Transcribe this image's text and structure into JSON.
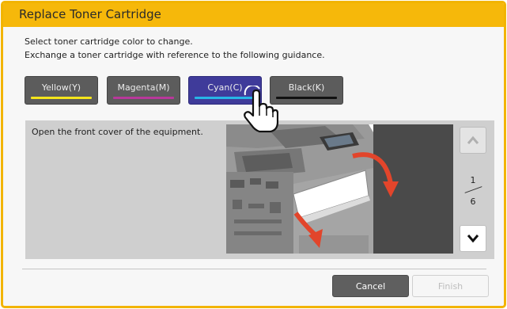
{
  "dialog": {
    "title": "Replace Toner Cartridge",
    "instruction_line1": "Select toner cartridge color to change.",
    "instruction_line2": "Exchange a toner cartridge with reference to the following guidance."
  },
  "colors": [
    {
      "label": "Yellow(Y)",
      "bar_color": "#f5e51b",
      "selected": false
    },
    {
      "label": "Magenta(M)",
      "bar_color": "#b8389b",
      "selected": false
    },
    {
      "label": "Cyan(C)",
      "bar_color": "#27b5e6",
      "selected": true
    },
    {
      "label": "Black(K)",
      "bar_color": "#111111",
      "selected": false
    }
  ],
  "guide": {
    "step_text": "Open the front cover of the equipment.",
    "current_page": "1",
    "total_pages": "6"
  },
  "footer": {
    "cancel_label": "Cancel",
    "finish_label": "Finish",
    "finish_enabled": false
  },
  "theme": {
    "title_bar": "#f6b80a",
    "selected_button": "#3f3b9a",
    "arrow_red": "#e2452b"
  }
}
